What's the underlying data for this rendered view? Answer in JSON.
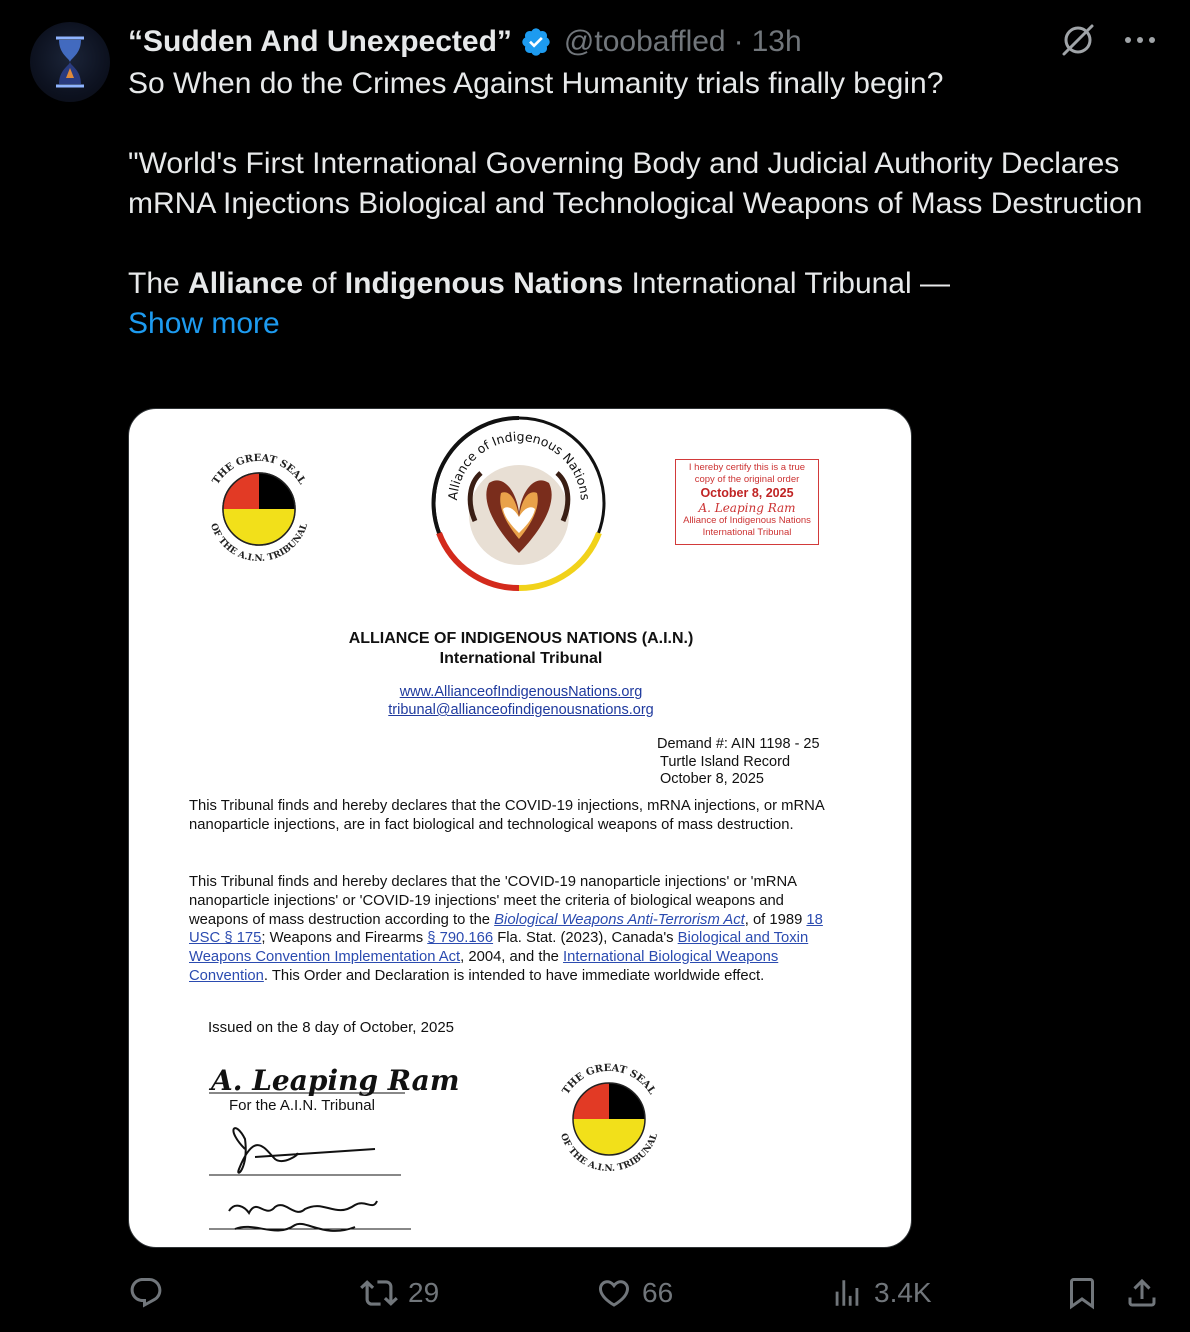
{
  "post": {
    "display_name": "“Sudden And Unexpected”",
    "handle": "@toobaffled",
    "separator": "·",
    "time": "13h",
    "line1": "So When do the Crimes Against Humanity trials finally begin?",
    "quote": "\"World's First International Governing Body and Judicial Authority Declares mRNA Injections Biological and Technological Weapons of Mass Destruction",
    "body_parts": [
      "The ",
      "Alliance",
      " of ",
      "Indigenous Nations",
      " International Tribunal —"
    ],
    "show_more": "Show more"
  },
  "document": {
    "seal_top_text": "THE GREAT SEAL",
    "seal_bottom_text": "OF THE A.I.N. TRIBUNAL",
    "logo_text": "Alliance of Indigenous Nations",
    "stamp": {
      "line1": "I hereby certify this is a true",
      "line2": "copy of the original order",
      "date": "October 8, 2025",
      "signature": "A. Leaping Ram",
      "line3": "Alliance of Indigenous Nations",
      "line4": "International Tribunal"
    },
    "org_title": "ALLIANCE OF INDIGENOUS NATIONS (A.I.N.)",
    "org_subtitle": "International Tribunal",
    "website": "www.AllianceofIndigenousNations.org",
    "email": "tribunal@allianceofindigenousnations.org",
    "demand": "Demand #: AIN 1198 - 25",
    "record": "Turtle Island Record",
    "record_date": "October 8, 2025",
    "para1": "This Tribunal finds and hereby declares that the COVID-19 injections, mRNA injections, or mRNA nanoparticle injections, are in fact biological and technological weapons of mass destruction.",
    "para2": {
      "t1": "This Tribunal finds and hereby declares that the 'COVID-19 nanoparticle injections' or 'mRNA nanoparticle injections' or 'COVID-19 injections' meet the criteria of biological weapons and weapons of mass destruction according to the ",
      "l1": "Biological Weapons Anti-Terrorism Act",
      "t2": ", of 1989 ",
      "l2": "18 USC § 175",
      "t3": "; Weapons and Firearms ",
      "l3": "§ 790.166",
      "t4": " Fla. Stat. (2023), Canada's ",
      "l4": "Biological and Toxin Weapons Convention Implementation Act",
      "t5": ", 2004, and the ",
      "l5": "International Biological Weapons Convention",
      "t6": ". This Order and Declaration is intended to have immediate worldwide effect."
    },
    "issued": "Issued on the 8 day of October, 2025",
    "signature": "A. Leaping Ram",
    "signature_caption": "For the A.I.N. Tribunal"
  },
  "actions": {
    "replies": "",
    "reposts": "29",
    "likes": "66",
    "views": "3.4K"
  },
  "colors": {
    "background": "#000000",
    "text": "#e7e9ea",
    "muted": "#71767b",
    "link": "#1d9bf0",
    "verified": "#1d9bf0"
  }
}
